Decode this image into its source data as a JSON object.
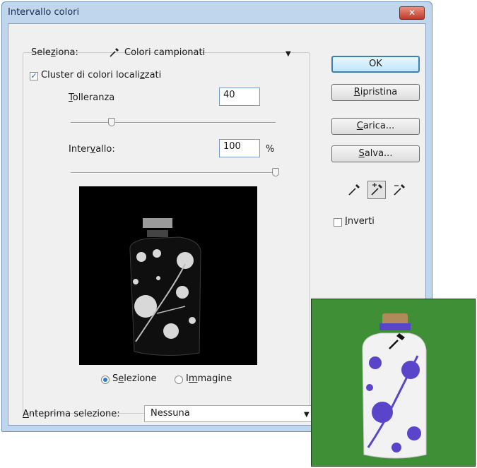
{
  "window": {
    "title": "Intervallo colori",
    "close_glyph": "✕"
  },
  "selection": {
    "label_pre": "Sele",
    "label_u": "z",
    "label_post": "iona:",
    "value": "Colori campionati",
    "icon": "eyedropper-icon"
  },
  "cluster": {
    "checked": true,
    "label_pre": "Cluster di colori locali",
    "label_u": "z",
    "label_post": "zati"
  },
  "tolerance": {
    "label_u": "T",
    "label_post": "olleranza",
    "value": "40",
    "level_percent": 20
  },
  "range": {
    "label_pre": "Inter",
    "label_u": "v",
    "label_post": "allo:",
    "value": "100",
    "unit": "%",
    "level_percent": 100
  },
  "view_mode": {
    "selection_pre": "S",
    "selection_u": "e",
    "selection_post": "lezione",
    "image_pre": "I",
    "image_u": "m",
    "image_post": "magine",
    "selected": "selezione"
  },
  "buttons": {
    "ok": "OK",
    "reset_u": "R",
    "reset_post": "ipristina",
    "load_u": "C",
    "load_post": "arica...",
    "save_u": "S",
    "save_post": "alva..."
  },
  "eyedroppers": [
    "eyedropper-icon",
    "eyedropper-plus-icon",
    "eyedropper-minus-icon"
  ],
  "invert": {
    "checked": false,
    "label_u": "I",
    "label_post": "nverti"
  },
  "preview_selection": {
    "label_u": "A",
    "label_post": "nteprima selezione:",
    "value": "Nessuna"
  },
  "colors": {
    "accent": "#3c7fb1",
    "title_bar": "#bfd6ec",
    "photo_background": "#3f8f36",
    "vase_pattern": "#5a44c9"
  }
}
